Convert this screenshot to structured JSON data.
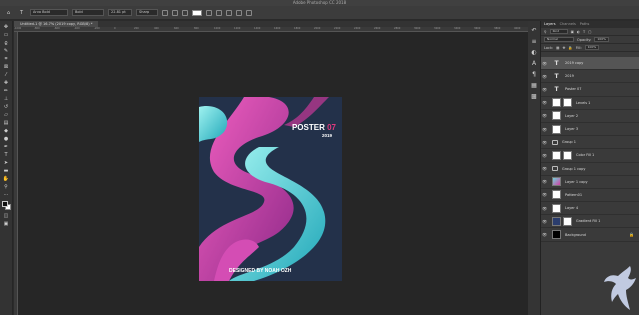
{
  "window": {
    "title": "Adobe Photoshop CC 2018"
  },
  "options": {
    "font_family": "Arvo Bold",
    "font_style": "Bold",
    "font_size": "22.81 pt",
    "antialias": "Sharp"
  },
  "document": {
    "tab_label": "Untitled-1 @ 16.7% (2019 copy, RGB/8) *"
  },
  "ruler": {
    "ticks": [
      "-1000",
      "-800",
      "-600",
      "-400",
      "-200",
      "0",
      "200",
      "400",
      "600",
      "800",
      "1000",
      "1200",
      "1400",
      "1600",
      "1800",
      "2000",
      "2200",
      "2400",
      "2600",
      "2800",
      "3000",
      "3200",
      "3400",
      "3600",
      "3800",
      "4000"
    ]
  },
  "poster": {
    "title_word": "POSTER",
    "title_number": "07",
    "year": "2019",
    "credit": "DESIGNED BY NOAH OZH"
  },
  "panels": {
    "tabs": [
      "Layers",
      "Channels",
      "Paths"
    ],
    "filter_label": "Kind",
    "blend_mode": "Normal",
    "opacity_label": "Opacity:",
    "opacity_value": "100%",
    "lock_label": "Lock:",
    "fill_label": "Fill:",
    "fill_value": "100%"
  },
  "layers": [
    {
      "name": "2019 copy",
      "thumb": "text",
      "selected": true
    },
    {
      "name": "2019",
      "thumb": "text"
    },
    {
      "name": "Poster 07",
      "thumb": "text"
    },
    {
      "name": "Levels 1",
      "thumb": "mask"
    },
    {
      "name": "Layer 2",
      "thumb": "white"
    },
    {
      "name": "Layer 3",
      "thumb": "white"
    },
    {
      "name": "Group 1",
      "thumb": "folder"
    },
    {
      "name": "Color Fill 1",
      "thumb": "mask"
    },
    {
      "name": "Group 1 copy",
      "thumb": "folder"
    },
    {
      "name": "Layer 1 copy",
      "thumb": "art"
    },
    {
      "name": "Pattern01",
      "thumb": "white"
    },
    {
      "name": "Layer 4",
      "thumb": "white"
    },
    {
      "name": "Gradient Fill 1",
      "thumb": "blue"
    },
    {
      "name": "Background",
      "thumb": "black"
    }
  ],
  "colors": {
    "accent": "#e0397f",
    "foreground": "#111111",
    "background": "#ffffff"
  }
}
